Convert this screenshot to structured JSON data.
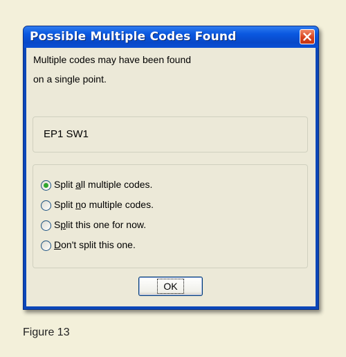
{
  "dialog": {
    "title": "Possible Multiple Codes Found",
    "message_line1": "Multiple codes may have been found",
    "message_line2": "on a single point.",
    "codes": "EP1 SW1",
    "options": [
      {
        "pre": "Split ",
        "key": "a",
        "post": "ll multiple codes.",
        "selected": true
      },
      {
        "pre": "Split ",
        "key": "n",
        "post": "o multiple codes.",
        "selected": false
      },
      {
        "pre": "S",
        "key": "p",
        "post": "lit this one for now.",
        "selected": false
      },
      {
        "pre": "",
        "key": "D",
        "post": "on't split this one.",
        "selected": false
      }
    ],
    "ok_label": "OK",
    "icons": {
      "close": "close-icon"
    },
    "colors": {
      "titlebar": "#0a58e0",
      "close": "#d8431e",
      "radio_dot": "#2fa62f",
      "face": "#ece9d8"
    }
  },
  "caption": "Figure 13"
}
